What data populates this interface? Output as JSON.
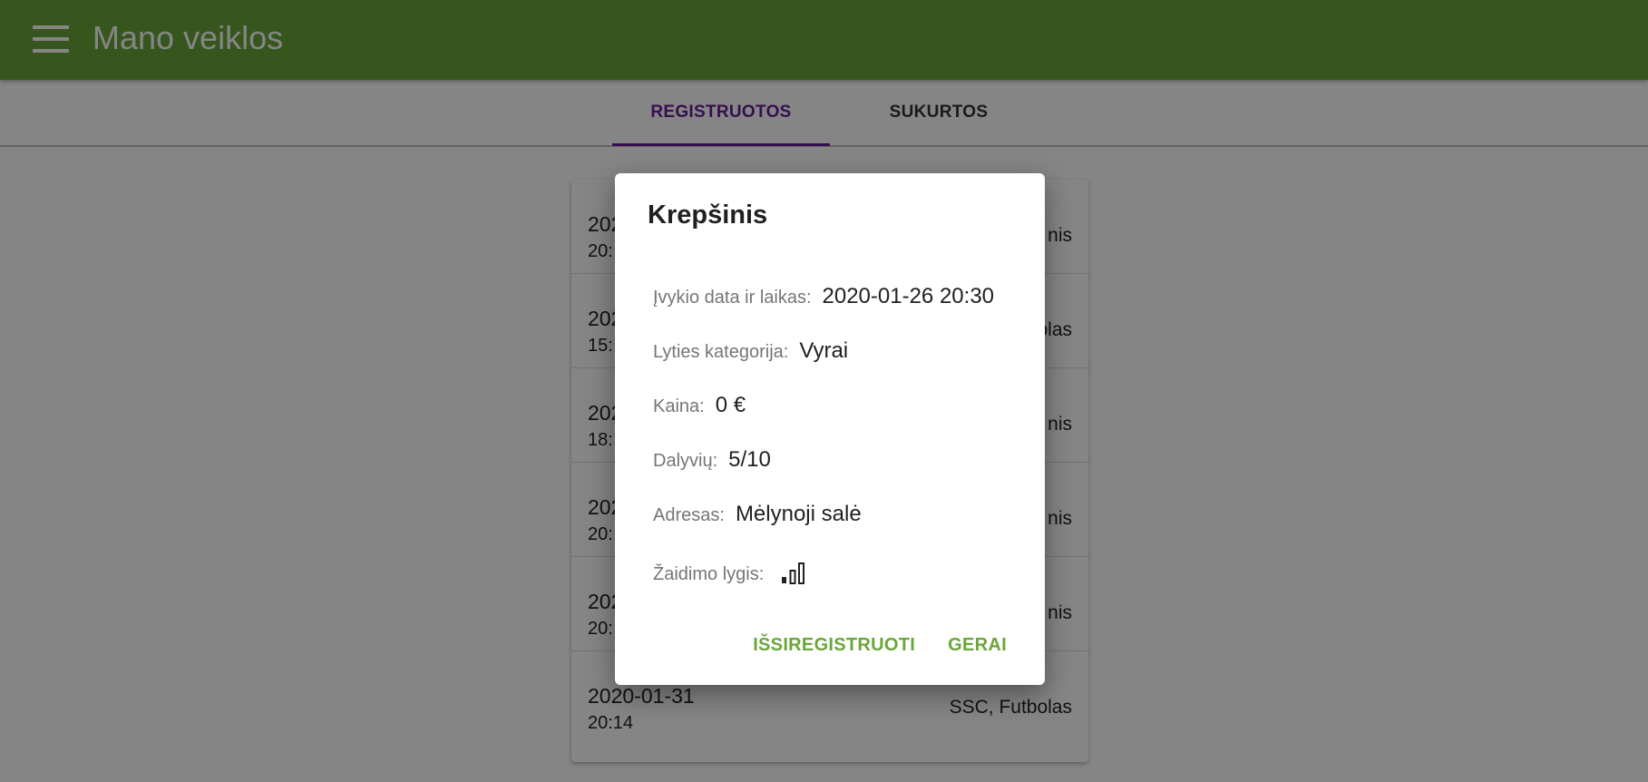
{
  "appbar": {
    "title": "Mano veiklos"
  },
  "tabs": [
    {
      "label": "REGISTRUOTOS",
      "active": true
    },
    {
      "label": "SUKURTOS",
      "active": false
    }
  ],
  "list": [
    {
      "date": "202",
      "time": "20:",
      "place": "nis"
    },
    {
      "date": "202",
      "time": "15:",
      "place": "blas"
    },
    {
      "date": "202",
      "time": "18:",
      "place": "nis"
    },
    {
      "date": "202",
      "time": "20:",
      "place": "nis"
    },
    {
      "date": "202",
      "time": "20:",
      "place": "nis"
    },
    {
      "date": "2020-01-31",
      "time": "20:14",
      "place": "SSC, Futbolas"
    }
  ],
  "dialog": {
    "title": "Krepšinis",
    "fields": {
      "datetime": {
        "label": "Įvykio data ir laikas:",
        "value": "2020-01-26 20:30"
      },
      "gender": {
        "label": "Lyties kategorija:",
        "value": "Vyrai"
      },
      "price": {
        "label": "Kaina:",
        "value": "0 €"
      },
      "participants": {
        "label": "Dalyvių:",
        "value": "5/10"
      },
      "address": {
        "label": "Adresas:",
        "value": "Mėlynoji salė"
      },
      "level": {
        "label": "Žaidimo lygis:",
        "icon": "signal-level-1-of-3-icon",
        "filled_bars": 1,
        "total_bars": 3
      }
    },
    "actions": {
      "unregister": "IŠSIREGISTRUOTI",
      "ok": "GERAI"
    }
  },
  "colors": {
    "primary": "#6aa63a",
    "tab_active": "#6a1b9a"
  }
}
